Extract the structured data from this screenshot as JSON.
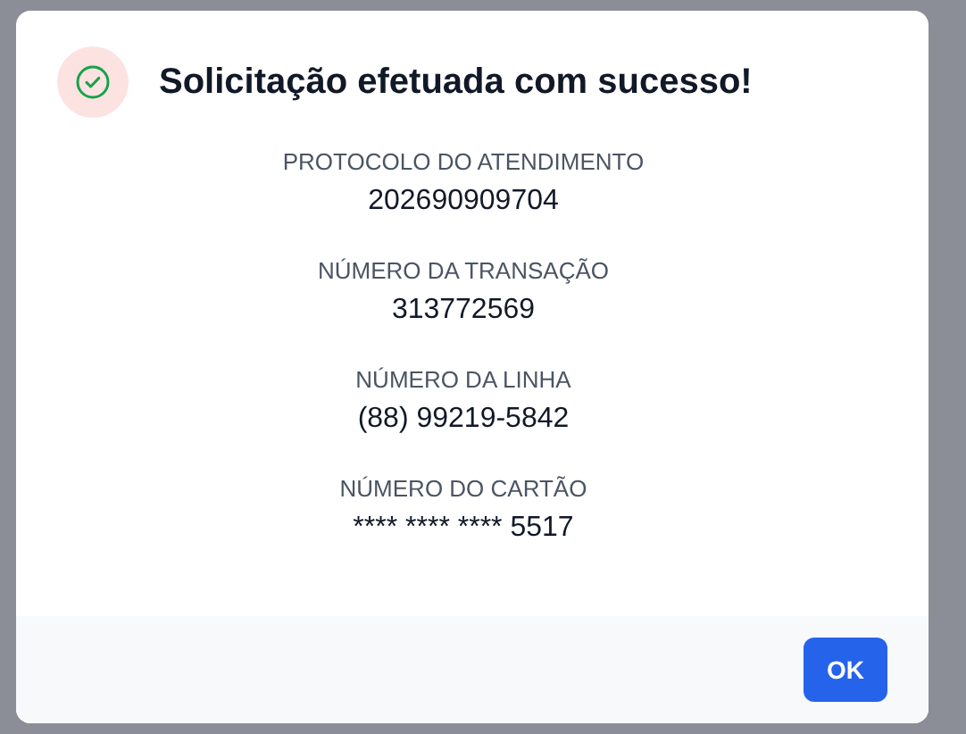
{
  "dialog": {
    "title": "Solicitação efetuada com sucesso!",
    "fields": [
      {
        "label": "PROTOCOLO DO ATENDIMENTO",
        "value": "202690909704"
      },
      {
        "label": "NÚMERO DA TRANSAÇÃO",
        "value": "313772569"
      },
      {
        "label": "NÚMERO DA LINHA",
        "value": "(88) 99219-5842"
      },
      {
        "label": "NÚMERO DO CARTÃO",
        "value": "**** **** **** 5517"
      }
    ],
    "buttons": [
      "OK"
    ]
  }
}
